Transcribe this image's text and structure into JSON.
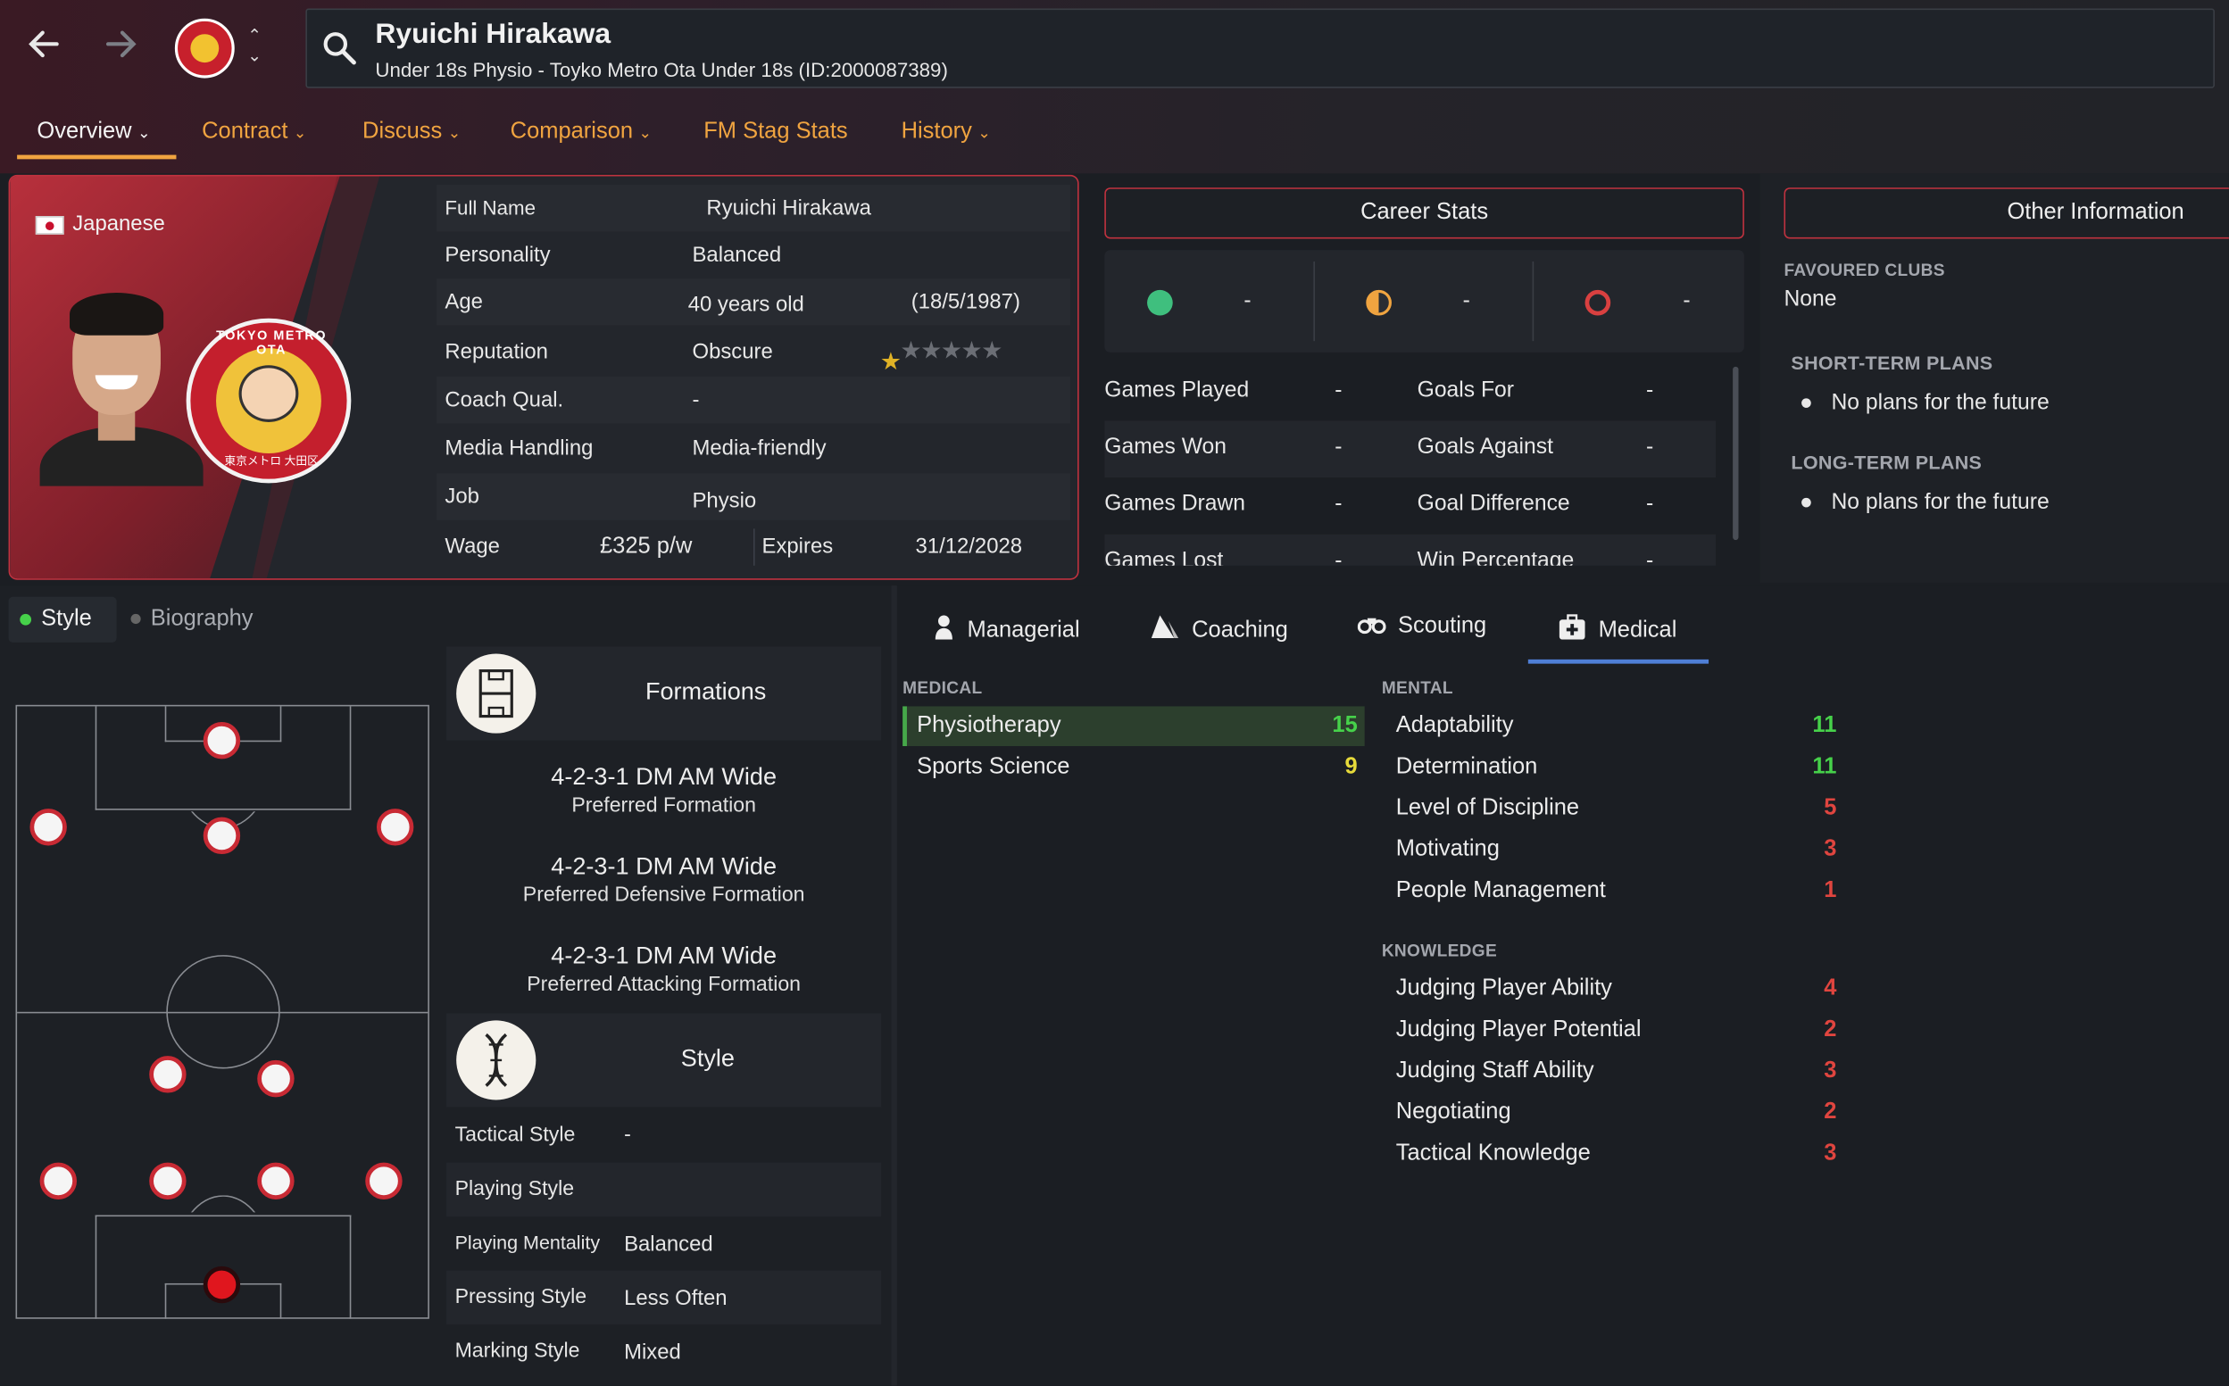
{
  "header": {
    "back_icon": "arrow-left-icon",
    "forward_icon": "arrow-right-icon",
    "name": "Ryuichi Hirakawa",
    "subtitle": "Under 18s Physio - Toyko Metro Ota Under 18s (ID:2000087389)"
  },
  "tabs": [
    {
      "label": "Overview",
      "active": true
    },
    {
      "label": "Contract"
    },
    {
      "label": "Discuss"
    },
    {
      "label": "Comparison"
    },
    {
      "label": "FM Stag Stats"
    },
    {
      "label": "History"
    }
  ],
  "profile": {
    "nationality": "Japanese",
    "club_logo_text_top": "TOKYO METRO OTA",
    "club_logo_text_bottom": "東京メトロ 大田区",
    "full_name_label": "Full Name",
    "full_name": "Ryuichi Hirakawa",
    "personality_label": "Personality",
    "personality": "Balanced",
    "age_label": "Age",
    "age": "40 years old",
    "dob": "(18/5/1987)",
    "reputation_label": "Reputation",
    "reputation": "Obscure",
    "reputation_stars": 0.5,
    "coach_qual_label": "Coach Qual.",
    "coach_qual": "-",
    "media_label": "Media Handling",
    "media": "Media-friendly",
    "job_label": "Job",
    "job": "Physio",
    "wage_label": "Wage",
    "wage": "£325 p/w",
    "expires_label": "Expires",
    "expires": "31/12/2028"
  },
  "career": {
    "title": "Career Stats",
    "summary": [
      "-",
      "-",
      "-"
    ],
    "left": [
      {
        "label": "Games Played",
        "value": "-"
      },
      {
        "label": "Games Won",
        "value": "-"
      },
      {
        "label": "Games Drawn",
        "value": "-"
      },
      {
        "label": "Games Lost",
        "value": "-"
      }
    ],
    "right": [
      {
        "label": "Goals For",
        "value": "-"
      },
      {
        "label": "Goals Against",
        "value": "-"
      },
      {
        "label": "Goal Difference",
        "value": "-"
      },
      {
        "label": "Win Percentage",
        "value": "-"
      }
    ]
  },
  "other": {
    "title": "Other Information",
    "favoured_label": "FAVOURED CLUBS",
    "favoured": "None",
    "short_label": "SHORT-TERM PLANS",
    "short": "No plans for the future",
    "long_label": "LONG-TERM PLANS",
    "long": "No plans for the future"
  },
  "style_tabs": {
    "style": "Style",
    "biography": "Biography"
  },
  "formations": {
    "title": "Formations",
    "items": [
      {
        "name": "4-2-3-1 DM AM Wide",
        "desc": "Preferred Formation"
      },
      {
        "name": "4-2-3-1 DM AM Wide",
        "desc": "Preferred Defensive Formation"
      },
      {
        "name": "4-2-3-1 DM AM Wide",
        "desc": "Preferred Attacking Formation"
      }
    ]
  },
  "style": {
    "title": "Style",
    "rows": [
      {
        "label": "Tactical Style",
        "value": "-"
      },
      {
        "label": "Playing Style",
        "value": ""
      },
      {
        "label": "Playing Mentality",
        "value": "Balanced"
      },
      {
        "label": "Pressing Style",
        "value": "Less Often"
      },
      {
        "label": "Marking Style",
        "value": "Mixed"
      }
    ]
  },
  "attr_tabs": [
    {
      "label": "Managerial",
      "icon": "person-icon"
    },
    {
      "label": "Coaching",
      "icon": "cone-icon"
    },
    {
      "label": "Scouting",
      "icon": "binoculars-icon"
    },
    {
      "label": "Medical",
      "icon": "medical-kit-icon",
      "active": true
    }
  ],
  "attributes": {
    "medical_label": "MEDICAL",
    "medical": [
      {
        "name": "Physiotherapy",
        "value": "15"
      },
      {
        "name": "Sports Science",
        "value": "9"
      }
    ],
    "mental_label": "MENTAL",
    "mental": [
      {
        "name": "Adaptability",
        "value": "11"
      },
      {
        "name": "Determination",
        "value": "11"
      },
      {
        "name": "Level of Discipline",
        "value": "5"
      },
      {
        "name": "Motivating",
        "value": "3"
      },
      {
        "name": "People Management",
        "value": "1"
      }
    ],
    "knowledge_label": "KNOWLEDGE",
    "knowledge": [
      {
        "name": "Judging Player Ability",
        "value": "4"
      },
      {
        "name": "Judging Player Potential",
        "value": "2"
      },
      {
        "name": "Judging Staff Ability",
        "value": "3"
      },
      {
        "name": "Negotiating",
        "value": "2"
      },
      {
        "name": "Tactical Knowledge",
        "value": "3"
      }
    ]
  },
  "colors": {
    "accent": "#f0a440",
    "border": "#c0323f",
    "good": "#46d14a",
    "mid": "#e6da3a",
    "bad": "#e0453f"
  }
}
